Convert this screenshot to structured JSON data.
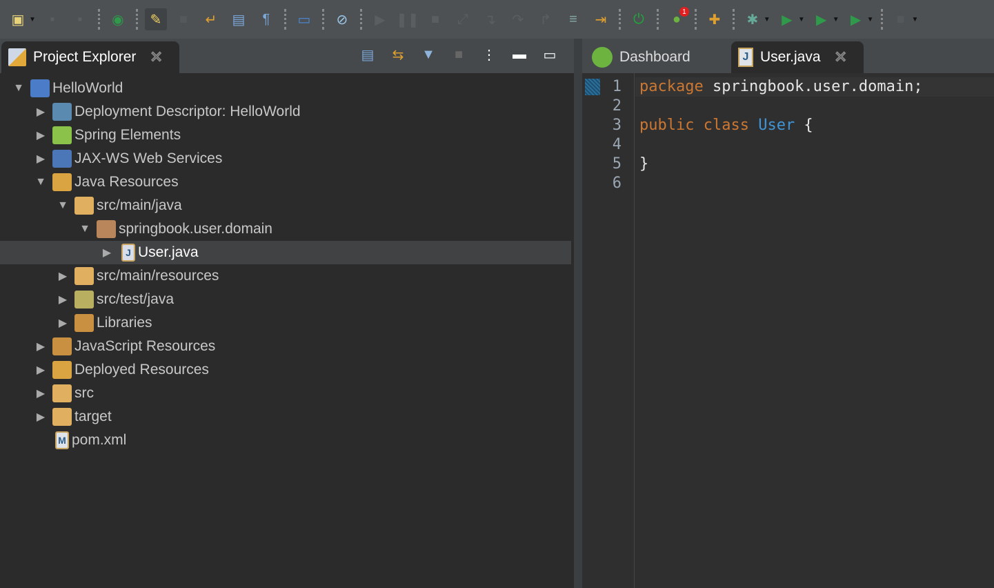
{
  "toolbar": {
    "items": [
      "new-icon",
      "save-icon",
      "save-all-icon",
      "new-class-icon",
      "highlight-icon",
      "server-icon",
      "word-wrap-icon",
      "block-select-icon",
      "pilcrow-icon",
      "console-icon",
      "skip-breakpoints-icon",
      "resume-icon",
      "suspend-icon",
      "terminate-icon",
      "disconnect-icon",
      "step-into-icon",
      "step-over-icon",
      "step-return-icon",
      "drop-frame-icon",
      "use-step-filters-icon",
      "power-icon",
      "spring-dashboard-icon",
      "new-spring-project-icon",
      "debug-icon",
      "run-icon",
      "coverage-icon",
      "external-tools-icon",
      "stop-icon"
    ],
    "badge": "1"
  },
  "left_panel": {
    "title": "Project Explorer"
  },
  "tree": [
    {
      "label": "HelloWorld",
      "level": 0,
      "expanded": true,
      "icon": "project-icon",
      "color": "#4a7cc7"
    },
    {
      "label": "Deployment Descriptor: HelloWorld",
      "level": 1,
      "expanded": false,
      "icon": "deployment-descriptor-icon",
      "color": "#5a8ab0"
    },
    {
      "label": "Spring Elements",
      "level": 1,
      "expanded": false,
      "icon": "spring-leaf-icon",
      "color": "#8bc34a"
    },
    {
      "label": "JAX-WS Web Services",
      "level": 1,
      "expanded": false,
      "icon": "web-services-icon",
      "color": "#4b76b8"
    },
    {
      "label": "Java Resources",
      "level": 1,
      "expanded": true,
      "icon": "java-resources-icon",
      "color": "#d9a441"
    },
    {
      "label": "src/main/java",
      "level": 2,
      "expanded": true,
      "icon": "source-folder-icon",
      "color": "#e0b060"
    },
    {
      "label": "springbook.user.domain",
      "level": 3,
      "expanded": true,
      "icon": "package-icon",
      "color": "#b8865a"
    },
    {
      "label": "User.java",
      "level": 4,
      "expanded": false,
      "icon": "java-file-icon",
      "color": "#d8dde8",
      "selected": true
    },
    {
      "label": "src/main/resources",
      "level": 2,
      "expanded": false,
      "icon": "source-folder-icon",
      "color": "#e0b060"
    },
    {
      "label": "src/test/java",
      "level": 2,
      "expanded": false,
      "icon": "source-folder-icon",
      "color": "#b8b060"
    },
    {
      "label": "Libraries",
      "level": 2,
      "expanded": false,
      "icon": "libraries-icon",
      "color": "#c89040"
    },
    {
      "label": "JavaScript Resources",
      "level": 1,
      "expanded": false,
      "icon": "javascript-resources-icon",
      "color": "#c89040"
    },
    {
      "label": "Deployed Resources",
      "level": 1,
      "expanded": false,
      "icon": "deployed-resources-icon",
      "color": "#d9a441"
    },
    {
      "label": "src",
      "level": 1,
      "expanded": false,
      "icon": "folder-icon",
      "color": "#e0b060"
    },
    {
      "label": "target",
      "level": 1,
      "expanded": false,
      "icon": "folder-icon",
      "color": "#e0b060"
    },
    {
      "label": "pom.xml",
      "level": 1,
      "expanded": null,
      "icon": "maven-pom-icon",
      "color": "#dfe3ea"
    }
  ],
  "editor": {
    "tabs": [
      {
        "label": "Dashboard",
        "active": false
      },
      {
        "label": "User.java",
        "active": true
      }
    ],
    "line_numbers": [
      "1",
      "2",
      "3",
      "4",
      "5",
      "6"
    ],
    "code": {
      "l1_kw": "package",
      "l1_rest": " springbook.user.domain;",
      "l3_kw": "public class",
      "l3_cls": "User",
      "l3_rest": " {",
      "l5": "}"
    }
  }
}
